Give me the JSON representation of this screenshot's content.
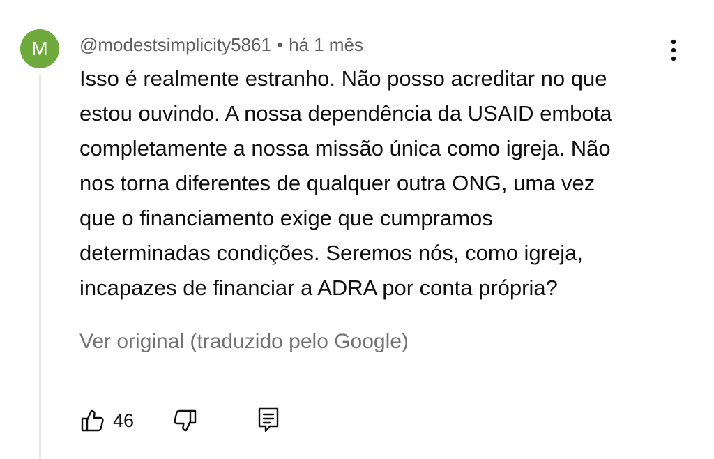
{
  "comment": {
    "avatar_letter": "M",
    "avatar_color": "#6faa3d",
    "author": "@modestsimplicity5861",
    "separator": "•",
    "time": "há 1 mês",
    "text_lines": [
      "Isso é realmente estranho. Não posso acreditar no que",
      "estou ouvindo. A nossa dependência da USAID embota",
      "completamente a nossa missão única como igreja. Não",
      "nos torna diferentes de qualquer outra ONG, uma vez",
      "que o financiamento exige que cumpramos",
      "determinadas condições. Seremos nós, como igreja,",
      "incapazes de financiar a ADRA por conta própria?"
    ],
    "translate_link": "Ver original (traduzido pelo Google)",
    "like_count": "46"
  },
  "icons": {
    "menu": "more-vertical-icon",
    "like": "thumb-up-icon",
    "dislike": "thumb-down-icon",
    "reply": "reply-comment-icon"
  }
}
